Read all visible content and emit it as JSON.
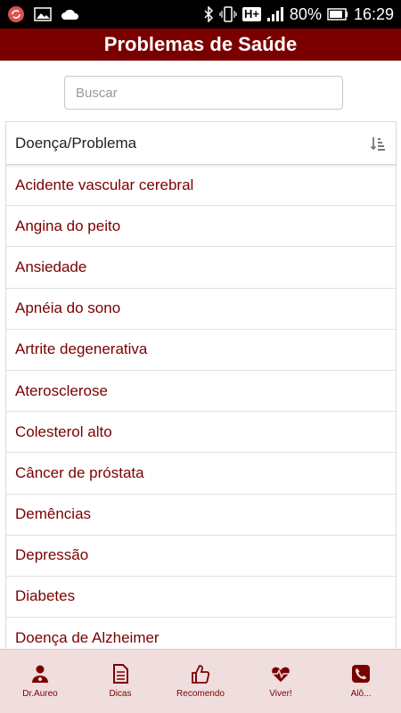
{
  "status_bar": {
    "signal_badge": "H+",
    "battery": "80%",
    "time": "16:29"
  },
  "header": {
    "title": "Problemas de Saúde"
  },
  "search": {
    "placeholder": "Buscar"
  },
  "list": {
    "header": "Doença/Problema",
    "items": [
      "Acidente vascular cerebral",
      "Angina do peito",
      "Ansiedade",
      "Apnéia do sono",
      "Artrite degenerativa",
      "Aterosclerose",
      "Colesterol alto",
      "Câncer de próstata",
      "Demências",
      "Depressão",
      "Diabetes",
      "Doença de Alzheimer"
    ]
  },
  "bottom_nav": [
    {
      "label": "Dr.Aureo",
      "icon": "doctor-icon"
    },
    {
      "label": "Dicas",
      "icon": "document-icon"
    },
    {
      "label": "Recomendo",
      "icon": "thumbs-up-icon"
    },
    {
      "label": "Viver!",
      "icon": "heartbeat-icon"
    },
    {
      "label": "Alô...",
      "icon": "phone-icon"
    }
  ],
  "colors": {
    "brand": "#7a0000",
    "nav_background": "#f0dede"
  }
}
